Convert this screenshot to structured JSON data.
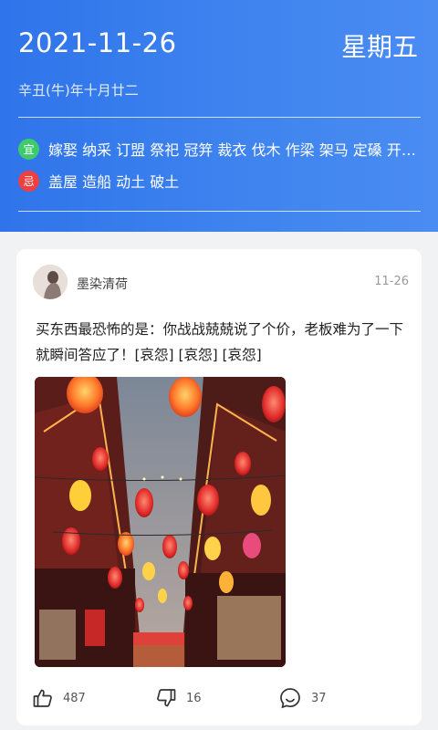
{
  "header": {
    "date": "2021-11-26",
    "weekday": "星期五",
    "lunar": "辛丑(牛)年十月廿二",
    "yi": {
      "badge": "宜",
      "items": "嫁娶 纳采 订盟 祭祀 冠笄 裁衣 伐木 作梁 架马 定磉 开…"
    },
    "ji": {
      "badge": "忌",
      "items": "盖屋 造船 动土 破土"
    },
    "colors": {
      "bg_start": "#2f74ea",
      "bg_end": "#4a8cf2",
      "yi_badge": "#3ecb6b",
      "ji_badge": "#ee4040"
    }
  },
  "post": {
    "username": "墨染清荷",
    "date": "11-26",
    "text": "买东西最恐怖的是：你战战兢兢说了个价，老板难为了一下就瞬间答应了！[哀怨] [哀怨] [哀怨]",
    "photo_icon": "street-lanterns-photo",
    "actions": {
      "like": {
        "icon": "thumbs-up-icon",
        "count": "487"
      },
      "dislike": {
        "icon": "thumbs-down-icon",
        "count": "16"
      },
      "comment": {
        "icon": "comment-icon",
        "count": "37"
      }
    }
  }
}
